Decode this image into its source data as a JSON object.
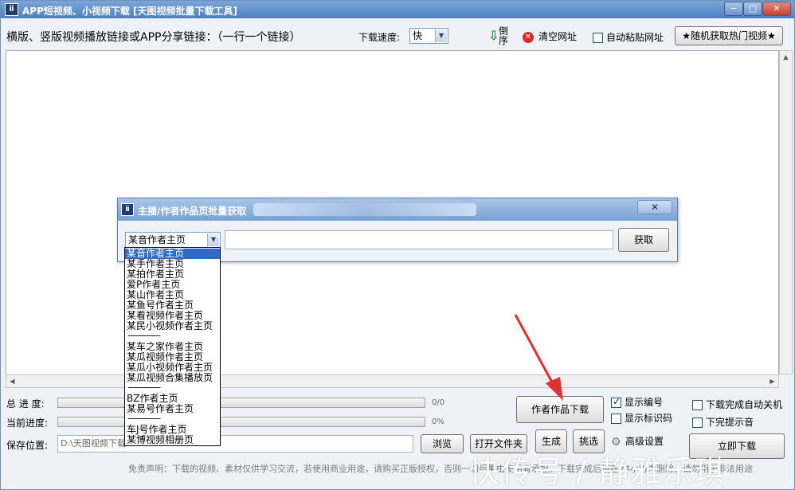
{
  "window": {
    "title": "APP短视频、小视频下载 [天图视频批量下载工具]",
    "min_label": "−",
    "max_label": "□",
    "close_label": "✕",
    "icon_glyph": "ⅱ"
  },
  "toolbar": {
    "instruction": "横版、竖版视频播放链接或APP分享链接：（一行一个链接）",
    "speed_label": "下载速度:",
    "speed_value": "快",
    "sort_label": "倒序",
    "clear_label": "清空网址",
    "autopaste_label": "自动粘贴网址",
    "random_label": "★随机获取热门视频★"
  },
  "progress": {
    "total_label": "总 进 度:",
    "total_value": "0/0",
    "current_label": "当前进度:",
    "current_value": "0%",
    "total_fraction": 0,
    "current_fraction": 0
  },
  "save": {
    "label": "保存位置:",
    "path": "D:\\天图视频下载",
    "browse_label": "浏览",
    "open_folder_label": "打开文件夹"
  },
  "actions": {
    "author_download_label": "作者作品下载",
    "generate_label": "生成",
    "pick_label": "挑选",
    "advanced_label": "高级设置",
    "start_label": "立即下载"
  },
  "options": {
    "show_number_label": "显示编号",
    "show_number_checked": true,
    "show_idcode_label": "显示标识码",
    "show_idcode_checked": false,
    "shutdown_label": "下载完成自动关机",
    "shutdown_checked": false,
    "sound_label": "下完提示音",
    "sound_checked": false
  },
  "disclaimer": "免责声明：下载的视频、素材仅供学习交流，若使用商业用途，请购买正版授权，否则一切后果由使用者承担。下载完成后请在24小时内删除，请勿用于非法用途",
  "watermark": "快传号 / 静雅乐琪",
  "dialog": {
    "title": "主播/作者作品页批量获取",
    "close_label": "✕",
    "select_value": "某音作者主页",
    "fetch_label": "获取",
    "input_value": ""
  },
  "dropdown": {
    "items": [
      "某音作者主页",
      "某手作者主页",
      "某拍作者主页",
      "爱P作者主页",
      "某山作者主页",
      "某鱼号作者主页",
      "某看视频作者主页",
      "某民小视频作者主页",
      "————",
      "某车之家作者主页",
      "某瓜视频作者主页",
      "某瓜小视频作者主页",
      "某瓜视频合集播放页",
      "————",
      "BZ作者主页",
      "某易号作者主页",
      "————",
      "车J号作者主页",
      "某博视频相册页"
    ],
    "selected_index": 0
  },
  "colors": {
    "accent": "#3169c6",
    "title_bar": "#4f7fbf",
    "arrow": "#e03030"
  }
}
